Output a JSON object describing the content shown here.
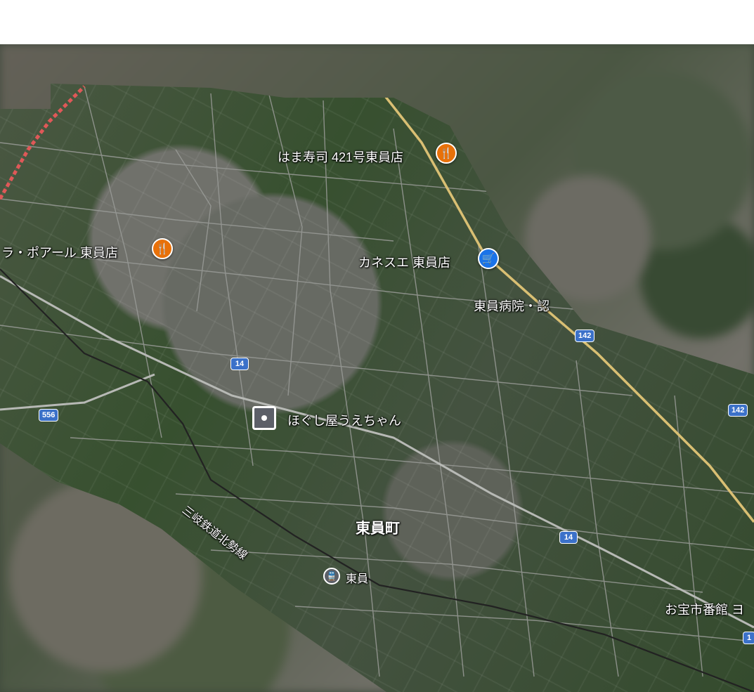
{
  "colors": {
    "restaurant_pin": "#e8710a",
    "shopping_pin": "#1a73e8",
    "route_shield": "#3b71c9",
    "highway": "#d9bf73",
    "railway_dash": "#e05858"
  },
  "places": {
    "hama_sushi": {
      "label": "はま寿司 421号東員店",
      "icon": "restaurant-icon"
    },
    "la_poire": {
      "label": "ラ・ポアール 東員店",
      "icon": "restaurant-icon"
    },
    "kanesue": {
      "label": "カネスエ 東員店",
      "icon": "shopping-cart-icon"
    },
    "hospital": {
      "label": "東員病院・認"
    },
    "hogushiya": {
      "label": "ほぐし屋うえちゃん",
      "icon": "selected-place-icon"
    },
    "town": {
      "label": "東員町"
    },
    "station": {
      "label": "東員",
      "icon": "train-station-icon"
    },
    "takara": {
      "label": "お宝市番館 ヨ"
    },
    "railway": {
      "label": "三岐鉄道北勢線"
    }
  },
  "routes": {
    "r142a": "142",
    "r142b": "142",
    "r14a": "14",
    "r14b": "14",
    "r556": "556",
    "r_edge": "1"
  }
}
